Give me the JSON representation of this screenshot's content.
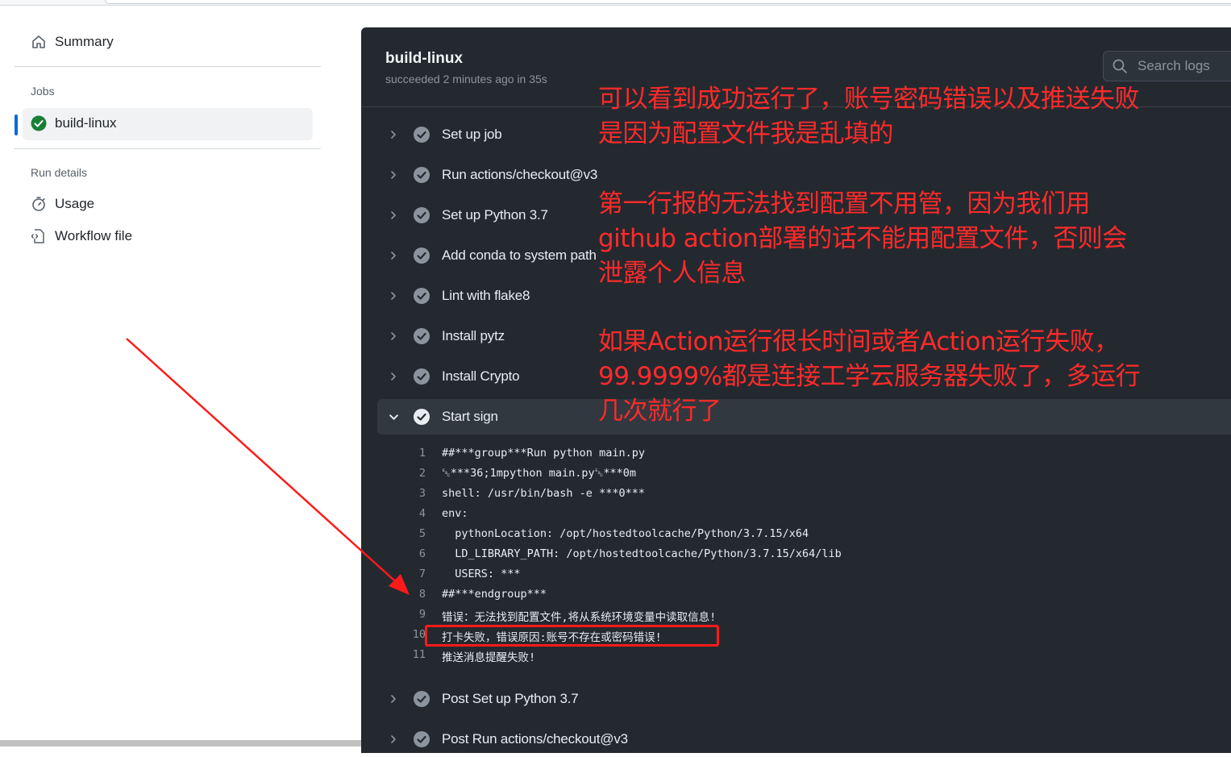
{
  "sidebar": {
    "summary_label": "Summary",
    "jobs_heading": "Jobs",
    "job_name": "build-linux",
    "run_details_heading": "Run details",
    "usage_label": "Usage",
    "workflow_label": "Workflow file"
  },
  "job": {
    "title": "build-linux",
    "status": "succeeded 2 minutes ago in 35s"
  },
  "search": {
    "placeholder": "Search logs"
  },
  "steps": [
    "Set up job",
    "Run actions/checkout@v3",
    "Set up Python 3.7",
    "Add conda to system path",
    "Lint with flake8",
    "Install pytz",
    "Install Crypto",
    "Start sign",
    "Post Set up Python 3.7",
    "Post Run actions/checkout@v3"
  ],
  "log": [
    {
      "n": "1",
      "text": "##***group***Run python main.py"
    },
    {
      "n": "2",
      "text": "␛***36;1mpython main.py␛***0m"
    },
    {
      "n": "3",
      "text": "shell: /usr/bin/bash -e ***0***"
    },
    {
      "n": "4",
      "text": "env:"
    },
    {
      "n": "5",
      "text": "  pythonLocation: /opt/hostedtoolcache/Python/3.7.15/x64"
    },
    {
      "n": "6",
      "text": "  LD_LIBRARY_PATH: /opt/hostedtoolcache/Python/3.7.15/x64/lib"
    },
    {
      "n": "7",
      "text": "  USERS: ***"
    },
    {
      "n": "8",
      "text": "##***endgroup***"
    },
    {
      "n": "9",
      "text": "错误：无法找到配置文件,将从系统环境变量中读取信息!"
    },
    {
      "n": "10",
      "text": "打卡失败，错误原因:账号不存在或密码错误!"
    },
    {
      "n": "11",
      "text": "推送消息提醒失败!"
    }
  ],
  "annotations": [
    "可以看到成功运行了，账号密码错误以及推送失败\n是因为配置文件我是乱填的",
    "第一行报的无法找到配置不用管，因为我们用\ngithub action部署的话不能用配置文件，否则会\n泄露个人信息",
    "如果Action运行很长时间或者Action运行失败，\n99.9999%都是连接工学云服务器失败了，多运行\n几次就行了"
  ],
  "colors": {
    "panel_bg": "#24292f",
    "success": "#1a7f37",
    "accent": "#0969da",
    "annotation_red": "#ff2a2a"
  }
}
